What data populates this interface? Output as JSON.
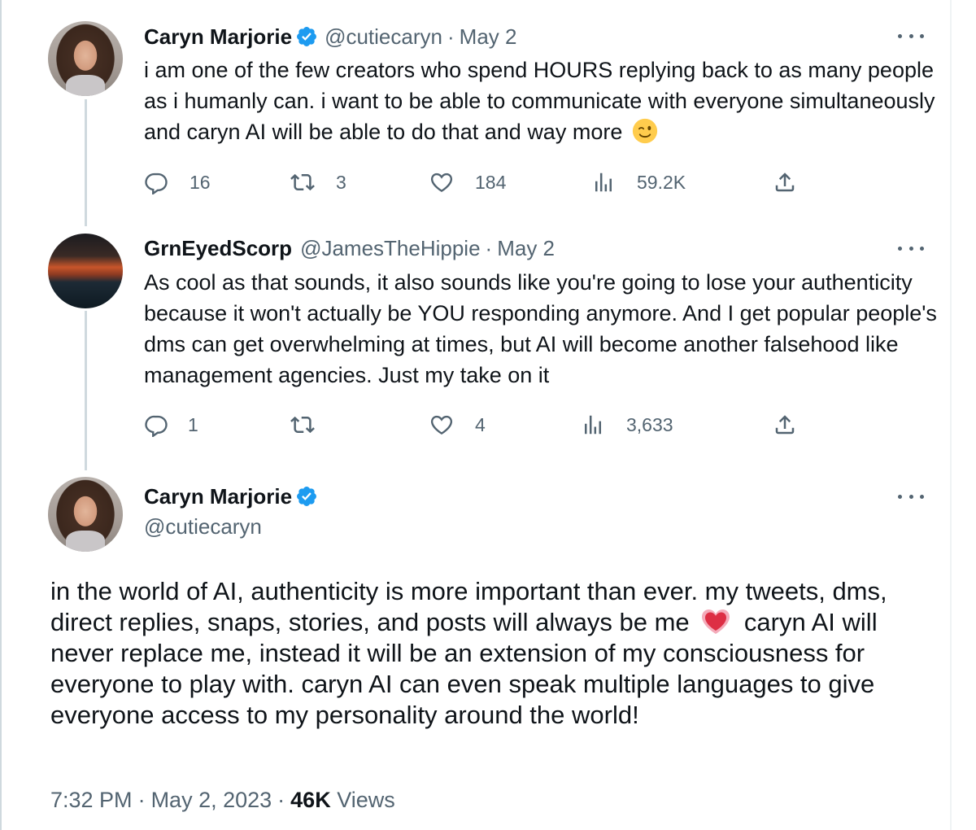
{
  "thread": [
    {
      "display_name": "Caryn Marjorie",
      "verified": true,
      "handle": "@cutiecaryn",
      "date": "May 2",
      "text": "i am one of the few creators who spend HOURS replying back to as many people as i humanly can. i want to be able to communicate with everyone simultaneously and caryn AI will be able to do that and way more",
      "emoji": "winking-face",
      "replies": "16",
      "retweets": "3",
      "likes": "184",
      "views": "59.2K"
    },
    {
      "display_name": "GrnEyedScorp",
      "verified": false,
      "handle": "@JamesTheHippie",
      "date": "May 2",
      "text": "As cool as that sounds, it also sounds like you're going to lose your authenticity because it won't actually be YOU responding anymore. And I get popular people's dms can get overwhelming at times, but AI will become another falsehood like management agencies. Just my take on it",
      "replies": "1",
      "retweets": "",
      "likes": "4",
      "views": "3,633"
    }
  ],
  "main_tweet": {
    "display_name": "Caryn Marjorie",
    "verified": true,
    "handle": "@cutiecaryn",
    "text_before_emoji": "in the world of AI, authenticity is more important than ever. my tweets, dms, direct replies, snaps, stories, and posts will always be me",
    "emoji": "growing-heart",
    "text_after_emoji": "caryn AI will never replace me, instead it will be an extension of my consciousness for everyone to play with. caryn AI can even speak multiple languages to give everyone access to my personality around the world!",
    "time": "7:32 PM",
    "date": "May 2, 2023",
    "views_count": "46K",
    "views_label": "Views"
  },
  "colors": {
    "text": "#0f1419",
    "secondary": "#536471",
    "verified": "#1d9bf0",
    "thread_line": "#cfd9de"
  }
}
